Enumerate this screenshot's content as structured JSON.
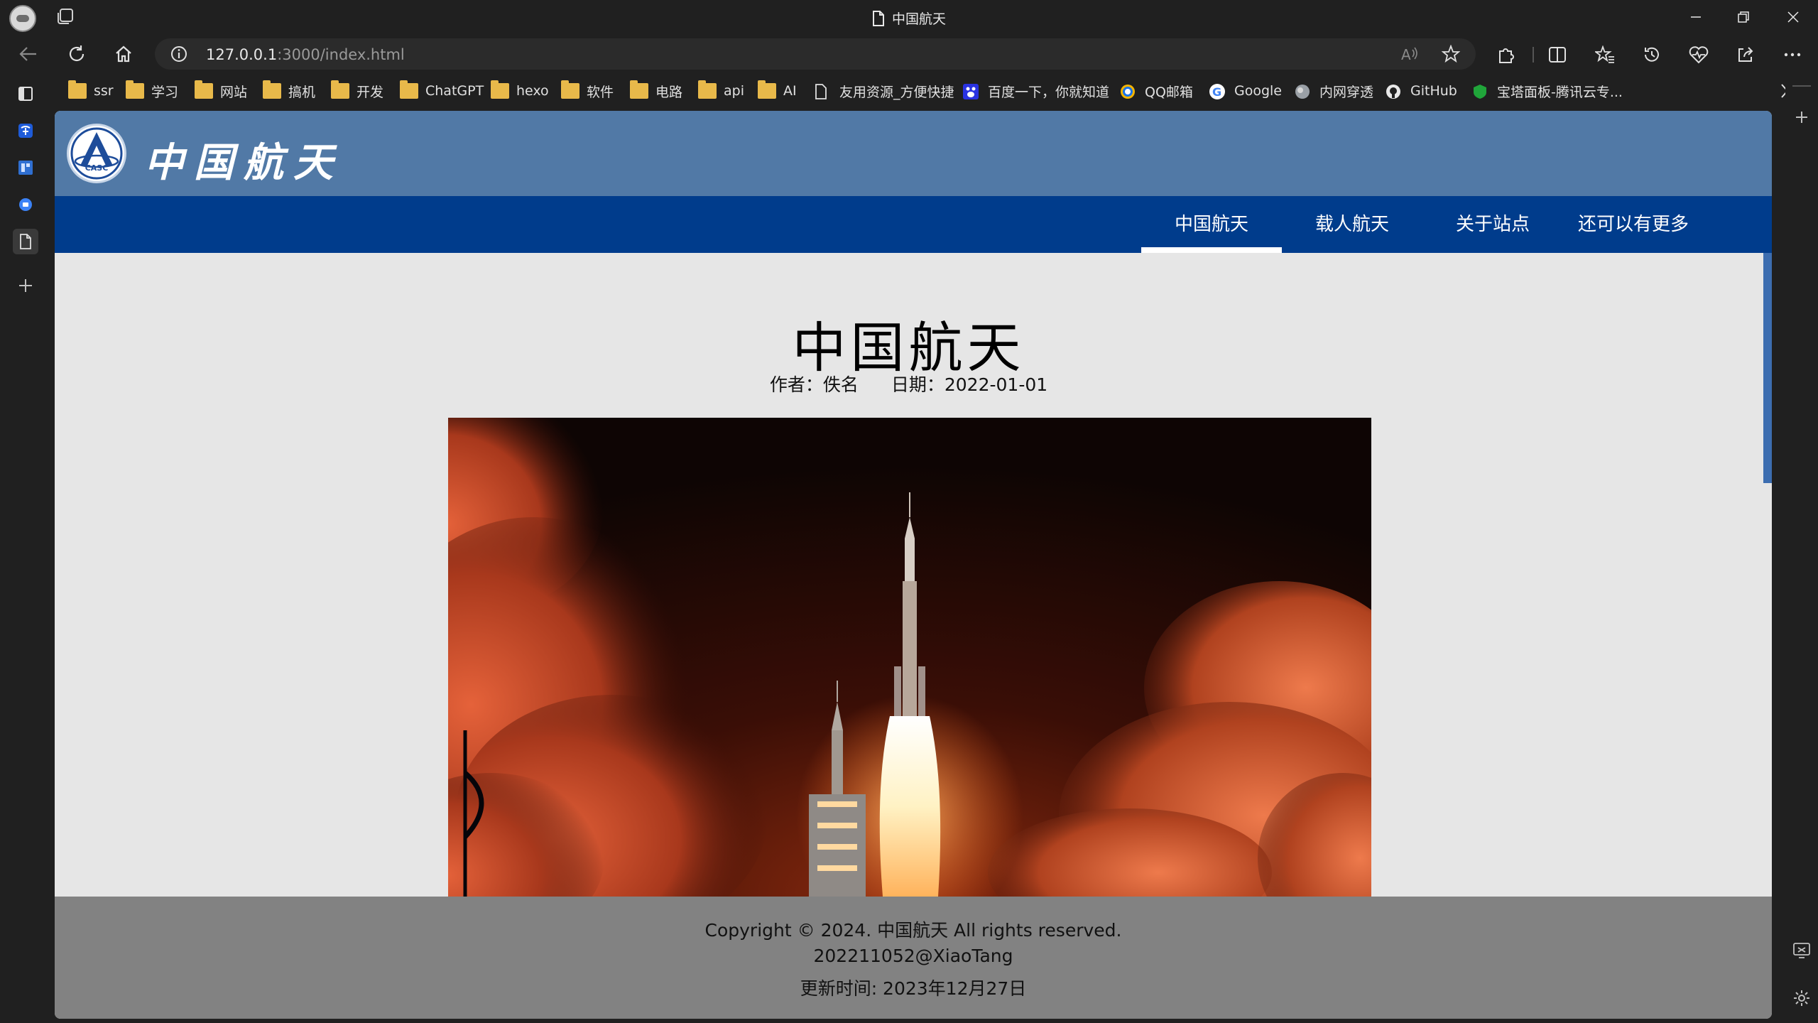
{
  "browser": {
    "window_title": "中国航天",
    "url_host": "127.0.0.1",
    "url_rest": ":3000/index.html",
    "bookmarks": [
      {
        "label": "ssr",
        "type": "folder"
      },
      {
        "label": "学习",
        "type": "folder"
      },
      {
        "label": "网站",
        "type": "folder"
      },
      {
        "label": "搞机",
        "type": "folder"
      },
      {
        "label": "开发",
        "type": "folder"
      },
      {
        "label": "ChatGPT",
        "type": "folder"
      },
      {
        "label": "hexo",
        "type": "folder"
      },
      {
        "label": "软件",
        "type": "folder"
      },
      {
        "label": "电路",
        "type": "folder"
      },
      {
        "label": "api",
        "type": "folder"
      },
      {
        "label": "AI",
        "type": "folder"
      },
      {
        "label": "友用资源_方便快捷",
        "type": "page"
      },
      {
        "label": "百度一下，你就知道",
        "type": "baidu"
      },
      {
        "label": "QQ邮箱",
        "type": "qq"
      },
      {
        "label": "Google",
        "type": "google"
      },
      {
        "label": "内网穿透",
        "type": "globe"
      },
      {
        "label": "GitHub",
        "type": "github"
      },
      {
        "label": "宝塔面板-腾讯云专...",
        "type": "bt"
      }
    ]
  },
  "site": {
    "logo_text": "中国航天",
    "logo_badge": "CASC",
    "nav": [
      {
        "label": "中国航天",
        "active": true
      },
      {
        "label": "载人航天",
        "active": false
      },
      {
        "label": "关于站点",
        "active": false
      },
      {
        "label": "还可以有更多",
        "active": false
      }
    ],
    "article": {
      "title": "中国航天",
      "author": "作者：佚名",
      "date": "日期：2022-01-01"
    },
    "footer": {
      "copyright": "Copyright © 2024. 中国航天 All rights reserved.",
      "id": "202211052@XiaoTang",
      "updated": "更新时间: 2023年12月27日"
    }
  },
  "colors": {
    "header_bg": "#5179a6",
    "nav_bg": "#003c8c",
    "footer_bg": "#828282",
    "page_bg": "#e6e6e6"
  }
}
